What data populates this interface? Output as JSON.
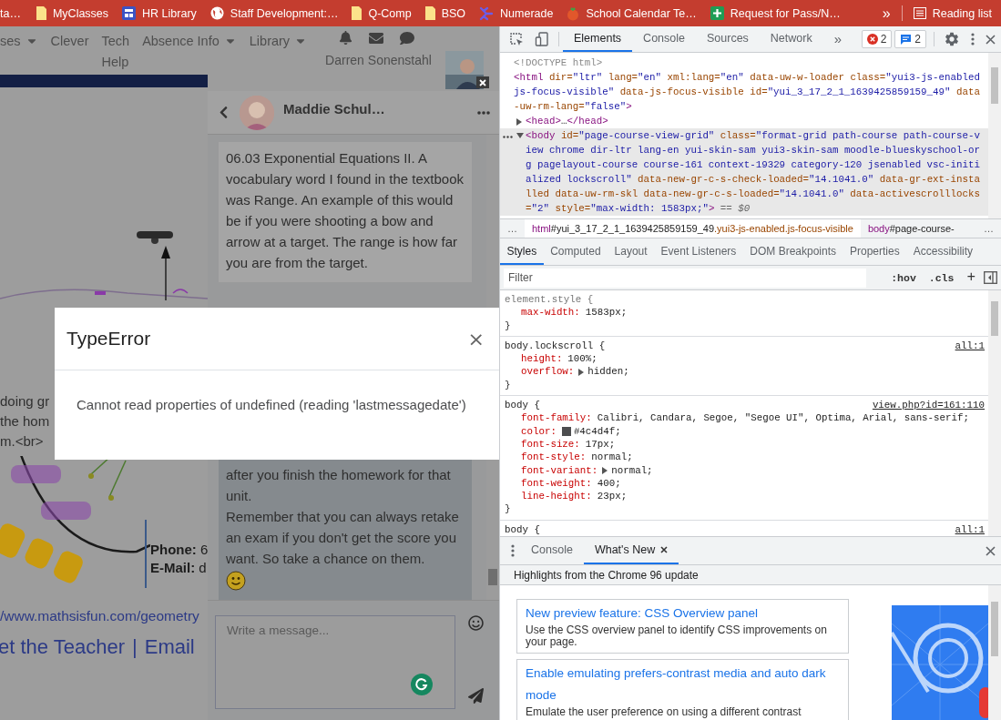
{
  "bookmarks_bar": {
    "items": [
      {
        "label": "ta…",
        "kind": "plain"
      },
      {
        "label": "MyClasses",
        "kind": "folder"
      },
      {
        "label": "HR Library",
        "kind": "grid"
      },
      {
        "label": "Staff Development:…",
        "kind": "globe"
      },
      {
        "label": "Q-Comp",
        "kind": "folder"
      },
      {
        "label": "BSO",
        "kind": "folder"
      },
      {
        "label": "Numerade",
        "kind": "branch"
      },
      {
        "label": "School Calendar Te…",
        "kind": "tomato"
      },
      {
        "label": "Request for Pass/N…",
        "kind": "plus"
      }
    ],
    "overflow": "»",
    "reading_list": "Reading list"
  },
  "page": {
    "nav": {
      "items": [
        {
          "label": "ses",
          "dropdown": true
        },
        {
          "label": "Clever",
          "dropdown": false
        },
        {
          "label": "Tech\nHelp",
          "dropdown": false
        },
        {
          "label": "Absence Info",
          "dropdown": true
        },
        {
          "label": "Library",
          "dropdown": true
        }
      ],
      "user_name": "Darren Sonenstahl"
    },
    "content": {
      "snippet_lines": [
        "doing gr",
        "the hom",
        "m.<br>"
      ],
      "contact_lines": [
        "**Phone:** 6",
        "**E-Mail:** d"
      ],
      "link": "/www.mathsisfun.com/geometry",
      "footer_links": [
        "et the Teacher",
        "Email"
      ],
      "footer_separator": "|"
    },
    "chat": {
      "contact_name": "Maddie Schul…",
      "messages": [
        {
          "text": "06.03 Exponential Equations II. A vocabulary word I found in the textbook was Range. An example of this would be if you were shooting a bow and arrow at a target. The range is how far you are from the target.",
          "own": false,
          "emoji": false
        },
        {
          "text": "after you finish the homework for that unit.\nRemember that you can always retake an exam if you don't get the score you want. So take a chance on them.",
          "own": true,
          "emoji": true
        }
      ],
      "composer": {
        "placeholder": "Write a message..."
      }
    },
    "error_dialog": {
      "title": "TypeError",
      "close": "×",
      "message": "Cannot read properties of undefined (reading 'lastmessagedate')"
    }
  },
  "devtools": {
    "toolbar": {
      "tabs": [
        {
          "label": "Elements",
          "selected": true
        },
        {
          "label": "Console",
          "selected": false
        },
        {
          "label": "Sources",
          "selected": false
        },
        {
          "label": "Network",
          "selected": false
        }
      ],
      "overflow": "»",
      "error_count": "2",
      "message_count": "2"
    },
    "dom": {
      "nodes": [
        {
          "selected": false,
          "tokens": [
            {
              "kind": "doctype",
              "text": "<!DOCTYPE html>"
            }
          ]
        },
        {
          "selected": false,
          "tokens": [
            {
              "kind": "tag",
              "text": "<html"
            },
            {
              "kind": "attr",
              "text": " dir="
            },
            {
              "kind": "value",
              "text": "\"ltr\""
            },
            {
              "kind": "attr",
              "text": " lang="
            },
            {
              "kind": "value",
              "text": "\"en\""
            },
            {
              "kind": "attr",
              "text": " xml:lang="
            },
            {
              "kind": "value",
              "text": "\"en\""
            },
            {
              "kind": "attr",
              "text": " data-uw-w-loader class="
            },
            {
              "kind": "value",
              "text": "\"yui3-js-enabled js-focus-visible\""
            },
            {
              "kind": "attr",
              "text": " data-js-focus-visible id="
            },
            {
              "kind": "value",
              "text": "\"yui_3_17_2_1_1639425859159_49\""
            },
            {
              "kind": "attr",
              "text": " data-uw-rm-lang="
            },
            {
              "kind": "value",
              "text": "\"false\""
            },
            {
              "kind": "tag",
              "text": ">"
            }
          ],
          "children": [
            {
              "selected": false,
              "expanded": false,
              "tokens": [
                {
                  "kind": "tag",
                  "text": "<head>"
                },
                {
                  "kind": "ellipsis",
                  "text": "…"
                },
                {
                  "kind": "tag",
                  "text": "</head>"
                }
              ]
            },
            {
              "selected": true,
              "expanded": true,
              "tokens": [
                {
                  "kind": "tag",
                  "text": "<body"
                },
                {
                  "kind": "attr",
                  "text": " id="
                },
                {
                  "kind": "value",
                  "text": "\"page-course-view-grid\""
                },
                {
                  "kind": "attr",
                  "text": " class="
                },
                {
                  "kind": "value",
                  "text": "\"format-grid path-course path-course-view chrome dir-ltr lang-en yui-skin-sam yui3-skin-sam moodle-blueskyschool-org pagelayout-course course-161 context-19329 category-120 jsenabled vsc-initialized lockscroll\""
                },
                {
                  "kind": "attr",
                  "text": " data-new-gr-c-s-check-loaded="
                },
                {
                  "kind": "value",
                  "text": "\"14.1041.0\""
                },
                {
                  "kind": "attr",
                  "text": " data-gr-ext-installed data-uw-rm-skl data-new-gr-c-s-loaded="
                },
                {
                  "kind": "value",
                  "text": "\"14.1041.0\""
                },
                {
                  "kind": "attr",
                  "text": " data-activescrolllocks="
                },
                {
                  "kind": "value",
                  "text": "\"2\""
                },
                {
                  "kind": "attr",
                  "text": " style="
                },
                {
                  "kind": "value",
                  "text": "\"max-width: 1583px;\""
                },
                {
                  "kind": "tag",
                  "text": ">"
                },
                {
                  "kind": "hint",
                  "text": " == $0"
                }
              ]
            }
          ]
        }
      ]
    },
    "breadcrumbs": {
      "lead": "…",
      "items": [
        {
          "tokens": [
            {
              "kind": "tag",
              "text": "html"
            },
            {
              "kind": "id",
              "text": "#yui_3_17_2_1_1639425859159_49"
            },
            {
              "kind": "class",
              "text": ".yui3-js-enabled.js-focus-visible"
            }
          ]
        },
        {
          "tokens": [
            {
              "kind": "tag",
              "text": "body"
            },
            {
              "kind": "id",
              "text": "#page-course-"
            }
          ]
        }
      ],
      "trail": "…"
    },
    "styles_tabs": [
      {
        "label": "Styles",
        "selected": true
      },
      {
        "label": "Computed",
        "selected": false
      },
      {
        "label": "Layout",
        "selected": false
      },
      {
        "label": "Event Listeners",
        "selected": false
      },
      {
        "label": "DOM Breakpoints",
        "selected": false
      },
      {
        "label": "Properties",
        "selected": false
      },
      {
        "label": "Accessibility",
        "selected": false
      }
    ],
    "filter": {
      "placeholder": "Filter",
      "buttons": [
        ":hov",
        ".cls",
        "+"
      ]
    },
    "rules": [
      {
        "selector": "element.style {",
        "props": [
          {
            "name": "max-width:",
            "value": "1583px;"
          }
        ],
        "close": "}"
      },
      {
        "selector": "body.lockscroll {",
        "source": "all:1",
        "props": [
          {
            "name": "height:",
            "value": "100%;"
          },
          {
            "name": "overflow:",
            "value": "hidden;",
            "expandable": true
          }
        ],
        "close": "}"
      },
      {
        "selector": "body {",
        "source": "view.php?id=161:110",
        "props": [
          {
            "name": "font-family:",
            "value": "Calibri, Candara, Segoe, \"Segoe UI\", Optima, Arial, sans-serif;"
          },
          {
            "name": "color:",
            "value": "#4c4d4f;",
            "color": "#4c4d4f"
          },
          {
            "name": "font-size:",
            "value": "17px;"
          },
          {
            "name": "font-style:",
            "value": "normal;"
          },
          {
            "name": "font-variant:",
            "value": "normal;",
            "expandable": true
          },
          {
            "name": "font-weight:",
            "value": "400;"
          },
          {
            "name": "line-height:",
            "value": "23px;"
          }
        ],
        "close": "}"
      },
      {
        "selector": "body {",
        "source": "all:1"
      }
    ],
    "drawer": {
      "tabs": [
        {
          "label": "Console",
          "selected": false,
          "closable": false
        },
        {
          "label": "What's New",
          "selected": true,
          "closable": true
        }
      ],
      "heading": "Highlights from the Chrome 96 update",
      "cards": [
        {
          "title": "New preview feature: CSS Overview panel",
          "description": "Use the CSS overview panel to identify CSS improvements on your page."
        },
        {
          "title": "Enable emulating prefers-contrast media and auto dark mode",
          "description": "Emulate the user preference on using a different contrast"
        }
      ]
    }
  }
}
